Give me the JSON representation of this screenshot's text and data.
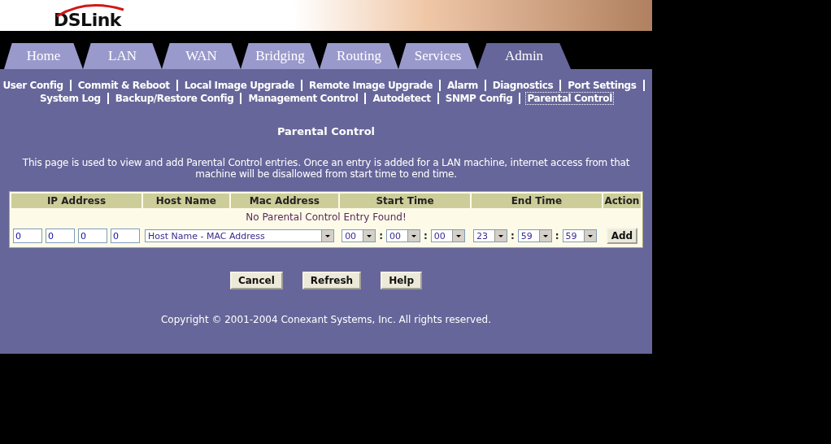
{
  "logo": {
    "text": "DSLink"
  },
  "tabs": [
    {
      "label": "Home",
      "selected": false
    },
    {
      "label": "LAN",
      "selected": false
    },
    {
      "label": "WAN",
      "selected": false
    },
    {
      "label": "Bridging",
      "selected": false
    },
    {
      "label": "Routing",
      "selected": false
    },
    {
      "label": "Services",
      "selected": false
    },
    {
      "label": "Admin",
      "selected": true
    }
  ],
  "link_rows": [
    [
      {
        "label": "User Config",
        "selected": false
      },
      {
        "label": "Commit & Reboot",
        "selected": false
      },
      {
        "label": "Local Image Upgrade",
        "selected": false
      },
      {
        "label": "Remote Image Upgrade",
        "selected": false
      },
      {
        "label": "Alarm",
        "selected": false
      },
      {
        "label": "Diagnostics",
        "selected": false
      },
      {
        "label": "Port Settings",
        "selected": false
      }
    ],
    [
      {
        "label": "System Log",
        "selected": false
      },
      {
        "label": "Backup/Restore Config",
        "selected": false
      },
      {
        "label": "Management Control",
        "selected": false
      },
      {
        "label": "Autodetect",
        "selected": false
      },
      {
        "label": "SNMP Config",
        "selected": false
      },
      {
        "label": "Parental Control",
        "selected": true
      }
    ]
  ],
  "heading": "Parental Control",
  "description": "This page is used to view and add Parental Control entries. Once an entry is added for a LAN machine, internet access from that machine will be disallowed from start time to end time.",
  "table": {
    "columns": [
      "IP Address",
      "Host Name",
      "Mac Address",
      "Start Time",
      "End Time",
      "Action"
    ],
    "empty_message": "No Parental Control Entry Found!",
    "add_row": {
      "ip": [
        "0",
        "0",
        "0",
        "0"
      ],
      "host": "Host Name - MAC Address",
      "time_separator": ":",
      "start_time": [
        "00",
        "00",
        "00"
      ],
      "end_time": [
        "23",
        "59",
        "59"
      ],
      "add_button": "Add"
    }
  },
  "buttons": [
    "Cancel",
    "Refresh",
    "Help"
  ],
  "copyright": "Copyright © 2001-2004 Conexant Systems, Inc. All rights reserved."
}
